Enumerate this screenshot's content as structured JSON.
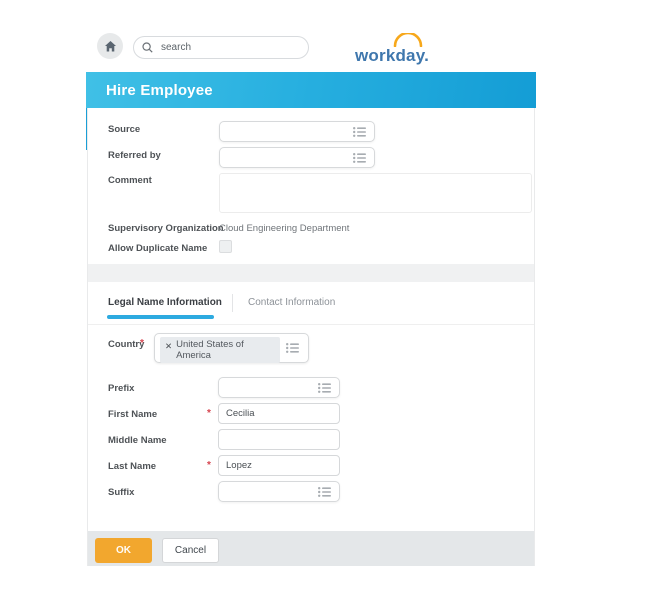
{
  "header": {
    "search_placeholder": "search",
    "logo_text": "workday."
  },
  "banner": {
    "title": "Hire Employee"
  },
  "form": {
    "source_label": "Source",
    "referred_label": "Referred by",
    "comment_label": "Comment",
    "supervisory_label": "Supervisory Organization",
    "supervisory_value": "Cloud Engineering Department",
    "allow_duplicate_label": "Allow Duplicate Name"
  },
  "tabs": [
    {
      "label": "Legal Name Information",
      "active": true
    },
    {
      "label": "Contact Information",
      "active": false
    }
  ],
  "name_form": {
    "country_label": "Country",
    "country_value": "United States of America",
    "prefix_label": "Prefix",
    "first_name_label": "First Name",
    "first_name_value": "Cecilia",
    "middle_name_label": "Middle Name",
    "middle_name_value": "",
    "last_name_label": "Last Name",
    "last_name_value": "Lopez",
    "suffix_label": "Suffix"
  },
  "footer": {
    "ok_label": "OK",
    "cancel_label": "Cancel"
  },
  "required_marker": "*",
  "icons": {
    "remove_glyph": "✕"
  },
  "colors": {
    "banner_start": "#40c0e6",
    "banner_end": "#149dd5",
    "accent_bar": "#1a9ed6",
    "tab_underline": "#2daae0",
    "ok_button": "#f2a72e",
    "logo_blue": "#3f77ad",
    "logo_arc": "#f7a81b",
    "required_red": "#d64550",
    "footer_bg": "#e4e7e9"
  }
}
